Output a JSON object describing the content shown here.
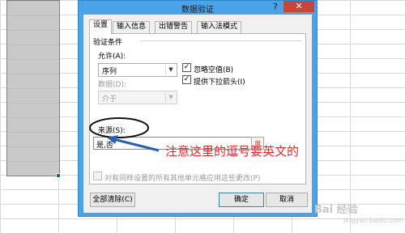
{
  "dialog": {
    "title": "数据验证",
    "help_glyph": "?",
    "close_glyph": "✕"
  },
  "tabs": [
    {
      "label": "设置",
      "active": true
    },
    {
      "label": "输入信息",
      "active": false
    },
    {
      "label": "出错警告",
      "active": false
    },
    {
      "label": "输入法模式",
      "active": false
    }
  ],
  "settings": {
    "group_title": "验证条件",
    "allow_label": "允许(A):",
    "allow_value": "序列",
    "ignore_blank_label": "忽略空值(B)",
    "ignore_blank_checked": true,
    "dropdown_label": "提供下拉箭头(I)",
    "dropdown_checked": true,
    "data_label": "数据(D):",
    "data_value": "介于",
    "source_label": "来源(S):",
    "source_value": "是,否",
    "apply_all_label": "对有同样设置的所有其他单元格应用这些更改(P)",
    "apply_all_checked": false,
    "check_glyph": "✓",
    "dropdown_arrow_glyph": "▼",
    "ref_glyph": "⊞"
  },
  "buttons": {
    "clear_all": "全部清除(C)",
    "ok": "确定",
    "cancel": "取消"
  },
  "annotation": {
    "text": "注意这里的逗号要英文的",
    "color": "#e8282b"
  },
  "watermark": {
    "text": "Bai 经验",
    "sub": "jingyan.baidu.com"
  },
  "colors": {
    "dialog_frame": "#4aa3e8",
    "close_button": "#c7463c",
    "selection": "#c9c9c9"
  }
}
